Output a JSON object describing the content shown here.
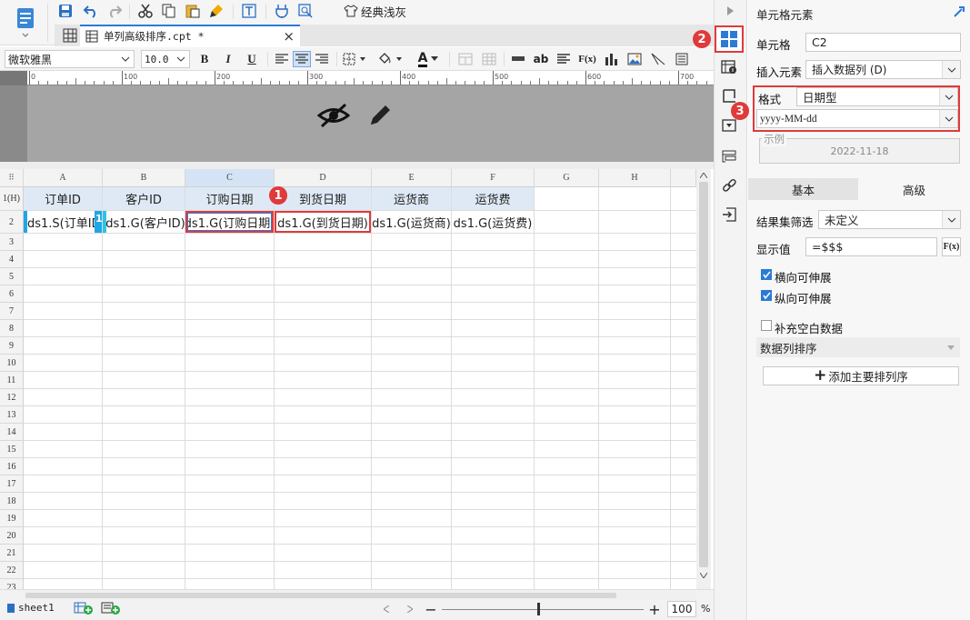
{
  "toolbar": {
    "theme_label": "经典浅灰",
    "font_name": "微软雅黑",
    "font_size": "10.0",
    "bold": "B",
    "italic": "I",
    "underline": "U",
    "text_a": "A",
    "ab": "ab",
    "fx": "F(x)"
  },
  "tab": {
    "title": "单列高级排序.cpt *",
    "close": "×"
  },
  "ruler": [
    "0",
    "100",
    "200",
    "300",
    "400",
    "500",
    "600",
    "700"
  ],
  "grid": {
    "corner": "⠿",
    "columns": [
      "A",
      "B",
      "C",
      "D",
      "E",
      "F",
      "G",
      "H"
    ],
    "rows": [
      "1(H)",
      "2",
      "3",
      "4",
      "5",
      "6",
      "7",
      "8",
      "9",
      "10",
      "11",
      "12",
      "13",
      "14",
      "15",
      "16",
      "17",
      "18",
      "19",
      "20",
      "21",
      "22",
      "23"
    ],
    "header_cells": [
      "订单ID",
      "客户ID",
      "订购日期",
      "到货日期",
      "运货商",
      "运货费"
    ],
    "data_cells": [
      "ds1.S(订单ID",
      "ds1.G(客户ID)",
      "ds1.G(订购日期)",
      "ds1.G(到货日期)",
      "ds1.G(运货商)",
      "ds1.G(运货费)"
    ],
    "expand_marker": "1"
  },
  "badges": [
    "1",
    "2",
    "3"
  ],
  "status": {
    "sheet": "sheet1",
    "zoom": "100",
    "percent": "%",
    "minus": "−",
    "plus": "+"
  },
  "panel": {
    "title": "单元格元素",
    "cell_label": "单元格",
    "cell_value": "C2",
    "insert_label": "插入元素",
    "insert_value": "插入数据列 (D)",
    "format_label": "格式",
    "format_type": "日期型",
    "format_pattern": "yyyy-MM-dd",
    "example_label": "示例",
    "example_value": "2022-11-18",
    "tab_basic": "基本",
    "tab_advanced": "高级",
    "filter_label": "结果集筛选",
    "filter_value": "未定义",
    "display_label": "显示值",
    "display_value": "=$$$",
    "fx": "F(x)",
    "h_expand": "横向可伸展",
    "v_expand": "纵向可伸展",
    "fill_blank": "补充空白数据",
    "sort_section": "数据列排序",
    "add_sort": "添加主要排列序",
    "add_plus": "+"
  },
  "colors": {
    "accent": "#2b7bd6",
    "highlight_red": "#e03a3a",
    "header_fill": "#dfe9f6",
    "ruler_bg": "#a5a5a5"
  }
}
